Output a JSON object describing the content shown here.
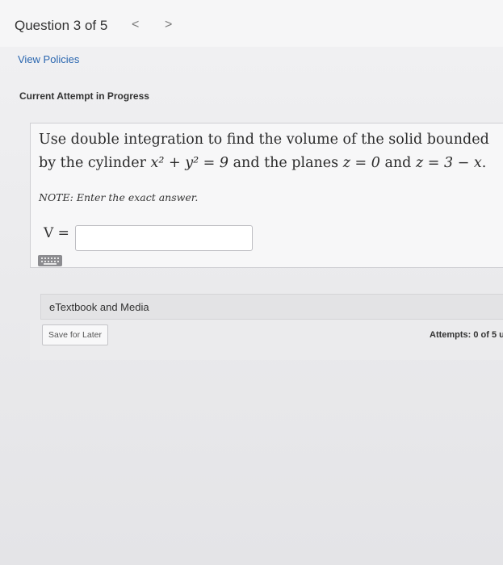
{
  "header": {
    "question_counter": "Question 3 of 5",
    "prev_label": "<",
    "next_label": ">"
  },
  "links": {
    "view_policies": "View Policies"
  },
  "status": {
    "attempt": "Current Attempt in Progress"
  },
  "question": {
    "line1": "Use double integration to find the volume of the solid bounded",
    "line2_prefix": "by the cylinder",
    "cylinder_eq": "x² + y² = 9",
    "line2_mid": "and the planes",
    "plane1": "z = 0",
    "and": "and",
    "plane2": "z = 3 − x",
    "period": ".",
    "note": "NOTE: Enter the exact answer.",
    "answer_label": "V =",
    "answer_value": ""
  },
  "resources": {
    "etextbook": "eTextbook and Media"
  },
  "footer": {
    "save_label": "Save for Later",
    "attempts": "Attempts: 0 of 5 u"
  },
  "icons": {
    "keypad": "keypad-icon"
  },
  "colors": {
    "link": "#2b67b0"
  }
}
